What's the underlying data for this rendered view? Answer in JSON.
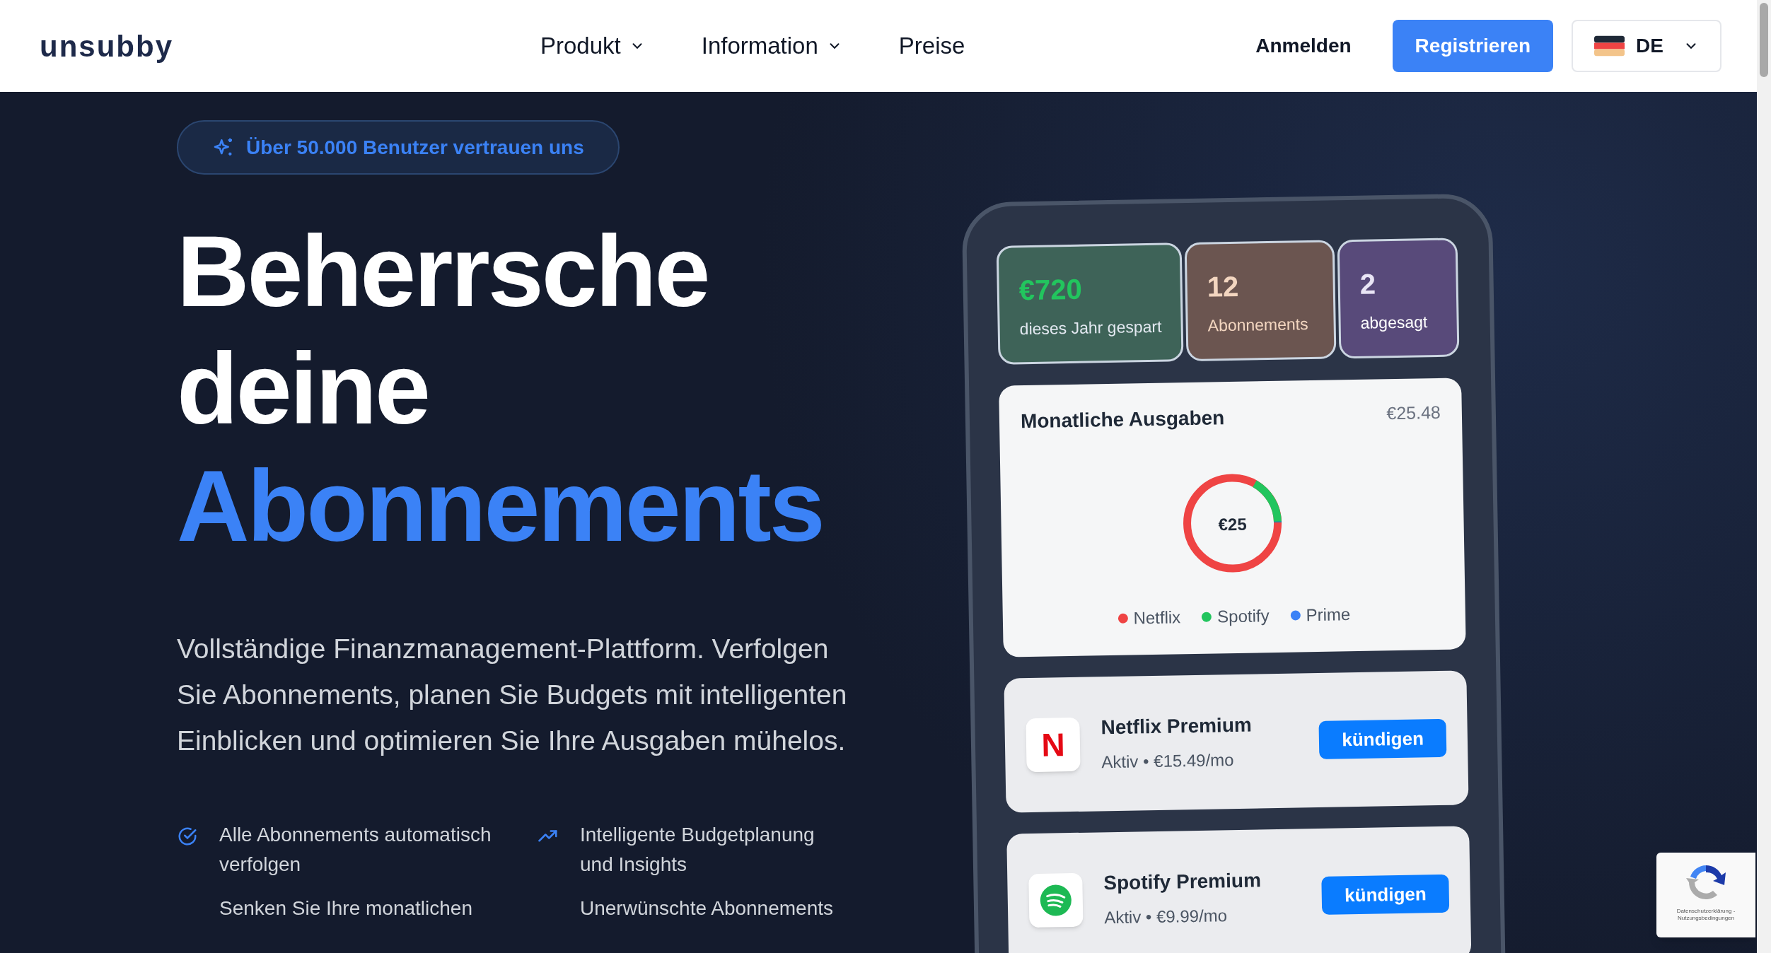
{
  "header": {
    "logo": "unsubby",
    "nav": [
      {
        "label": "Produkt",
        "dropdown": true
      },
      {
        "label": "Information",
        "dropdown": true
      },
      {
        "label": "Preise",
        "dropdown": false
      }
    ],
    "login": "Anmelden",
    "register": "Registrieren",
    "language": "DE"
  },
  "hero": {
    "badge": "Über 50.000 Benutzer vertrauen uns",
    "headline_lines": [
      "Beherrsche",
      "deine"
    ],
    "headline_highlight": "Abonnements",
    "description": "Vollständige Finanzmanagement-Plattform. Verfolgen Sie Abonnements, planen Sie Budgets mit intelligenten Einblicken und optimieren Sie Ihre Ausgaben mühelos.",
    "features": [
      {
        "kind": "check",
        "text": "Alle Abonnements automatisch verfolgen"
      },
      {
        "kind": "trend",
        "text": "Intelligente Budgetplanung und Insights"
      },
      {
        "kind": "none",
        "text": "Senken Sie Ihre monatlichen"
      },
      {
        "kind": "none",
        "text": "Unerwünschte Abonnements"
      }
    ]
  },
  "phone": {
    "stats": [
      {
        "kind": "saved",
        "value": "€720",
        "label": "dieses Jahr gespart"
      },
      {
        "kind": "count",
        "value": "12",
        "label": "Abonnements"
      },
      {
        "kind": "cancelled",
        "value": "2",
        "label": "abgesagt"
      }
    ],
    "spending": {
      "title": "Monatliche Ausgaben",
      "total": "€25.48",
      "center": "€25",
      "legend": [
        {
          "label": "Netflix",
          "color": "#ef4444"
        },
        {
          "label": "Spotify",
          "color": "#22c55e"
        },
        {
          "label": "Prime",
          "color": "#3b82f6"
        }
      ]
    },
    "subscriptions": [
      {
        "kind": "netflix",
        "logo_text": "N",
        "name": "Netflix Premium",
        "status": "Aktiv • €15.49/mo",
        "action": "kündigen"
      },
      {
        "kind": "spotify",
        "name": "Spotify Premium",
        "status": "Aktiv • €9.99/mo",
        "action": "kündigen"
      }
    ]
  },
  "recaptcha": {
    "links": "Datenschutzerklärung - Nutzungsbedingungen"
  }
}
